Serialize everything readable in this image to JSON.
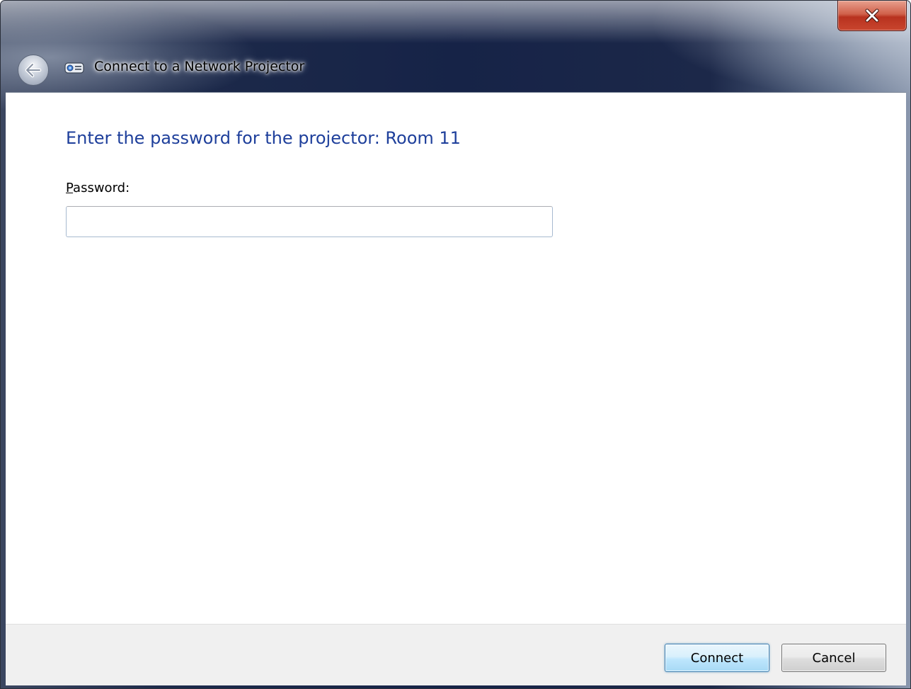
{
  "window": {
    "title": "Connect to a Network Projector"
  },
  "main": {
    "heading": "Enter the password for the projector: Room 11",
    "password_label_accel": "P",
    "password_label_rest": "assword:",
    "password_value": "",
    "password_placeholder": ""
  },
  "footer": {
    "connect_label": "Connect",
    "cancel_label": "Cancel"
  },
  "colors": {
    "heading": "#1e3f9b",
    "title_bar": "#162347",
    "close_button": "#c9452e"
  },
  "icons": {
    "close": "close-icon",
    "back": "back-arrow-icon",
    "app": "projector-icon"
  }
}
